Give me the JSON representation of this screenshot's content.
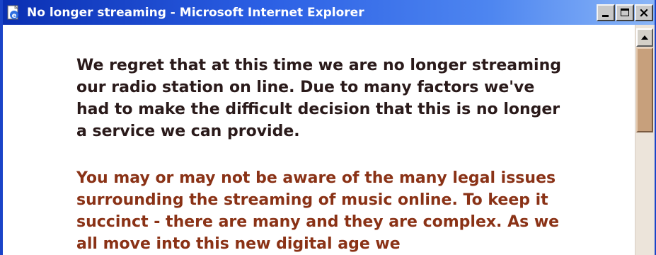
{
  "window": {
    "title": "No longer streaming - Microsoft Internet Explorer",
    "app_icon": "internet-explorer-icon",
    "controls": {
      "minimize": "minimize-icon",
      "maximize": "maximize-icon",
      "close": "×"
    }
  },
  "content": {
    "paragraph1": "We regret that at this time we are no longer streaming our radio station on line. Due to many factors we've had to make the difficult decision that this is no longer a service we can provide.",
    "paragraph2": "You may or may not be aware of the many legal issues surrounding the streaming of music online. To keep it succinct - there are many and they are complex. As we all move into this new digital age we"
  },
  "scrollbar": {
    "up_arrow": "scroll-up-arrow-icon"
  },
  "colors": {
    "titlebar_start": "#0a2fb2",
    "titlebar_end": "#8bb6f7",
    "paragraph1_text": "#2a1a1a",
    "paragraph2_text": "#8a3216",
    "scroll_thumb": "#c7a07c",
    "scroll_track": "#ece4da"
  }
}
